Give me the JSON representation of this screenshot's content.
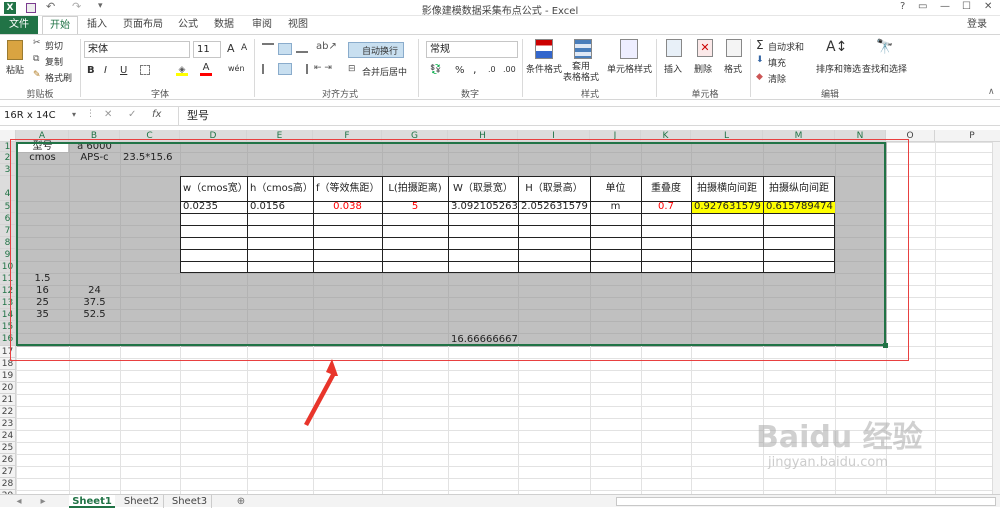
{
  "title": "影像建模数据采集布点公式 - Excel",
  "win_ctrls": [
    "?",
    "▭",
    "—",
    "☐",
    "✕"
  ],
  "login": "登录",
  "menu": {
    "file": "文件",
    "tabs": [
      "开始",
      "插入",
      "页面布局",
      "公式",
      "数据",
      "审阅",
      "视图"
    ]
  },
  "ribbon": {
    "clip": {
      "paste": "粘贴",
      "cut": "剪切",
      "copy": "复制",
      "fmt": "格式刷",
      "group": "剪贴板"
    },
    "font": {
      "name": "宋体",
      "size": "11",
      "grow": "A",
      "shrink": "A",
      "bold": "B",
      "italic": "I",
      "underline": "U",
      "phonetic": "wén",
      "group": "字体"
    },
    "align": {
      "wrap": "自动换行",
      "merge": "合并后居中",
      "group": "对齐方式"
    },
    "number": {
      "format": "常规",
      "group": "数字",
      "pct": "%",
      "comma": ",",
      "inc": ".0",
      ".00": ".00"
    },
    "styles": {
      "cond": "条件格式",
      "table": "套用\n表格格式",
      "cell": "单元格样式",
      "group": "样式"
    },
    "cells": {
      "insert": "插入",
      "delete": "删除",
      "format": "格式",
      "group": "单元格"
    },
    "edit": {
      "autosum": "自动求和",
      "fill": "填充",
      "clear": "清除",
      "sort": "排序和筛选",
      "find": "查找和选择",
      "group": "编辑"
    }
  },
  "namebox": "16R x 14C",
  "fx": "fx",
  "formula": "型号",
  "cols": [
    "A",
    "B",
    "C",
    "D",
    "E",
    "F",
    "G",
    "H",
    "I",
    "J",
    "K",
    "L",
    "M",
    "N",
    "O",
    "P"
  ],
  "cells": {
    "A1": "型号",
    "B1": "a 6000",
    "A2": "cmos",
    "B2": "APS-c",
    "C2": "23.5*15.6",
    "D4": "w（cmos宽）",
    "E4": "h（cmos高）",
    "F4": "f（等效焦距）",
    "G4": "L(拍摄距离)",
    "H4": "W（取景宽）",
    "I4": "H（取景高）",
    "J4": "单位",
    "K4": "重叠度",
    "L4": "拍摄横向间距",
    "M4": "拍摄纵向间距",
    "D5": "0.0235",
    "E5": "0.0156",
    "F5": "0.038",
    "G5": "5",
    "H5": "3.092105263",
    "I5": "2.052631579",
    "J5": "m",
    "K5": "0.7",
    "L5": "0.927631579",
    "M5": "0.615789474",
    "A11": "1.5",
    "A12": "16",
    "B12": "24",
    "A13": "25",
    "B13": "37.5",
    "A14": "35",
    "B14": "52.5",
    "H16": "16.66666667"
  },
  "sheets": [
    "Sheet1",
    "Sheet2",
    "Sheet3"
  ],
  "watermark": {
    "brand": "Baidu 经验",
    "url": "jingyan.baidu.com"
  },
  "colors": {
    "excel_green": "#217346",
    "selection": "#c0c0c0",
    "highlight": "#ffff00",
    "red": "#ff0000"
  }
}
